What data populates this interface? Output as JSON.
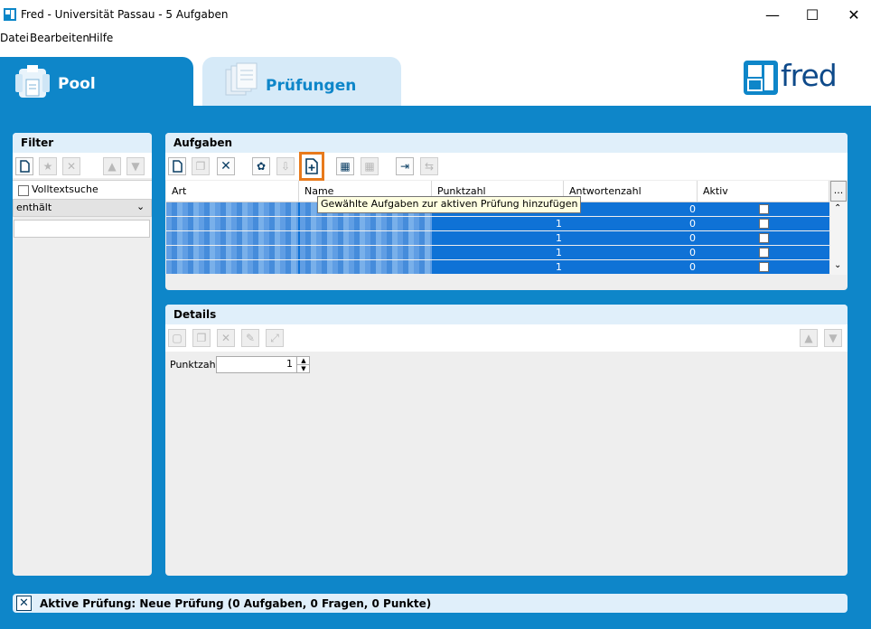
{
  "window": {
    "title": "Fred - Universität Passau - 5 Aufgaben",
    "minimize": "—",
    "maximize": "☐",
    "close": "✕"
  },
  "menu": [
    "Datei",
    "Bearbeiten",
    "Hilfe"
  ],
  "tabs": {
    "pool": "Pool",
    "pruefungen": "Prüfungen"
  },
  "logo": "fred",
  "filter": {
    "title": "Filter",
    "volltext_label": "Volltextsuche",
    "match_mode": "enthält",
    "search_value": ""
  },
  "aufgaben": {
    "title": "Aufgaben",
    "columns": [
      "Art",
      "Name",
      "Punktzahl",
      "Antwortenzahl",
      "Aktiv"
    ],
    "more_label": "...",
    "tooltip": "Gewählte Aufgaben zur aktiven Prüfung hinzufügen",
    "rows": [
      {
        "punktzahl": "1",
        "antwortenzahl": "0",
        "aktiv": false
      },
      {
        "punktzahl": "1",
        "antwortenzahl": "0",
        "aktiv": false
      },
      {
        "punktzahl": "1",
        "antwortenzahl": "0",
        "aktiv": false
      },
      {
        "punktzahl": "1",
        "antwortenzahl": "0",
        "aktiv": false
      },
      {
        "punktzahl": "1",
        "antwortenzahl": "0",
        "aktiv": false
      }
    ]
  },
  "details": {
    "title": "Details",
    "punktzahl_label": "Punktzahl",
    "punktzahl_value": "1"
  },
  "status": {
    "text": "Aktive Prüfung: Neue Prüfung (0 Aufgaben, 0 Fragen, 0 Punkte)"
  },
  "colors": {
    "brand_blue": "#0e86c9",
    "selection_blue": "#0f72d6",
    "highlight_orange": "#e87a1c"
  }
}
